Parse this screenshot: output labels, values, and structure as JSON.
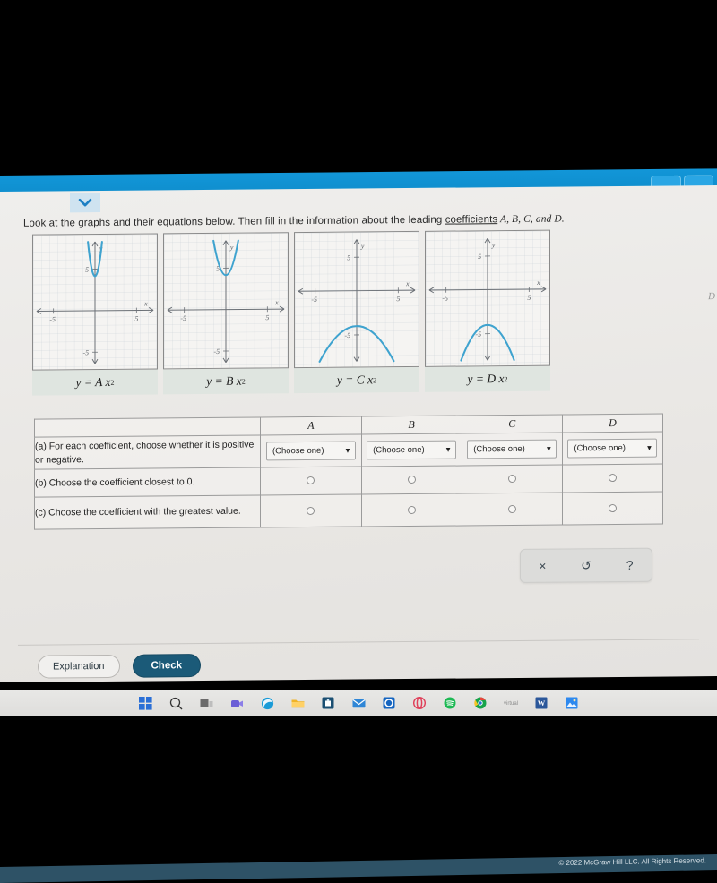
{
  "window": {
    "chrome_color": "#1296d8",
    "chevron_icon": "chevron-down-icon"
  },
  "prompt": {
    "text_before_link": "Look at the graphs and their equations below. Then fill in the information about the leading ",
    "link_text": "coefficients",
    "text_after_link": " A, B, C, and D."
  },
  "graphs": [
    {
      "id": "A",
      "equation_prefix": "y = A x",
      "equation_exponent": "2",
      "direction": "up",
      "width_label": "narrow",
      "x_tick_left": "-5",
      "x_tick_right": "5",
      "y_tick_top": "5",
      "y_tick_bottom": "-5",
      "x_axis_label": "x",
      "y_axis_label": "y"
    },
    {
      "id": "B",
      "equation_prefix": "y = B x",
      "equation_exponent": "2",
      "direction": "up",
      "width_label": "narrow-medium",
      "x_tick_left": "-5",
      "x_tick_right": "5",
      "y_tick_top": "5",
      "y_tick_bottom": "-5",
      "x_axis_label": "x",
      "y_axis_label": "y"
    },
    {
      "id": "C",
      "equation_prefix": "y = C x",
      "equation_exponent": "2",
      "direction": "down",
      "width_label": "wide",
      "x_tick_left": "-5",
      "x_tick_right": "5",
      "y_tick_top": "5",
      "y_tick_bottom": "-5",
      "x_axis_label": "x",
      "y_axis_label": "y"
    },
    {
      "id": "D",
      "equation_prefix": "y = D x",
      "equation_exponent": "2",
      "direction": "down",
      "width_label": "medium",
      "x_tick_left": "-5",
      "x_tick_right": "5",
      "y_tick_top": "5",
      "y_tick_bottom": "-5",
      "x_axis_label": "x",
      "y_axis_label": "y"
    }
  ],
  "ghost_label": "D",
  "table": {
    "column_headers": [
      "",
      "A",
      "B",
      "C",
      "D"
    ],
    "rows": [
      {
        "label": "(a) For each coefficient, choose whether it is positive or negative.",
        "control": "dropdown",
        "cells": [
          "(Choose one)",
          "(Choose one)",
          "(Choose one)",
          "(Choose one)"
        ],
        "caret": "▼"
      },
      {
        "label": "(b) Choose the coefficient closest to 0.",
        "control": "radio",
        "cells": [
          "",
          "",
          "",
          ""
        ],
        "caret": ""
      },
      {
        "label": "(c) Choose the coefficient with the greatest value.",
        "control": "radio",
        "cells": [
          "",
          "",
          "",
          ""
        ],
        "caret": ""
      }
    ]
  },
  "util_toolbar": {
    "buttons": [
      {
        "name": "clear-button",
        "glyph": "×"
      },
      {
        "name": "undo-button",
        "glyph": "↺"
      },
      {
        "name": "help-button",
        "glyph": "?"
      }
    ]
  },
  "actions": {
    "explanation_label": "Explanation",
    "check_label": "Check",
    "check_color": "#1b5a78"
  },
  "footer": {
    "copyright": "© 2022 McGraw Hill LLC. All Rights Reserved.",
    "strip_color": "#2e5266"
  },
  "taskbar": {
    "items": [
      {
        "name": "start-icon",
        "color": "#2a6fd6"
      },
      {
        "name": "search-icon",
        "color": "#333333"
      },
      {
        "name": "task-view-icon",
        "color": "#3a3a3a"
      },
      {
        "name": "teams-icon",
        "color": "#5b5fc7"
      },
      {
        "name": "edge-icon",
        "color": "#1a9bd7"
      },
      {
        "name": "file-explorer-icon",
        "color": "#f0b429"
      },
      {
        "name": "microsoft-store-icon",
        "color": "#1b4f72"
      },
      {
        "name": "mail-icon",
        "color": "#1c74c4"
      },
      {
        "name": "outlook-icon",
        "color": "#1565c0"
      },
      {
        "name": "opera-icon",
        "color": "#e0405a"
      },
      {
        "name": "spotify-icon",
        "color": "#1db954"
      },
      {
        "name": "chrome-icon",
        "color": "#17a34a"
      },
      {
        "name": "app-icon",
        "color": "#9a9a9a"
      },
      {
        "name": "word-icon",
        "color": "#2b579a"
      },
      {
        "name": "photos-icon",
        "color": "#2d89ef"
      }
    ]
  }
}
